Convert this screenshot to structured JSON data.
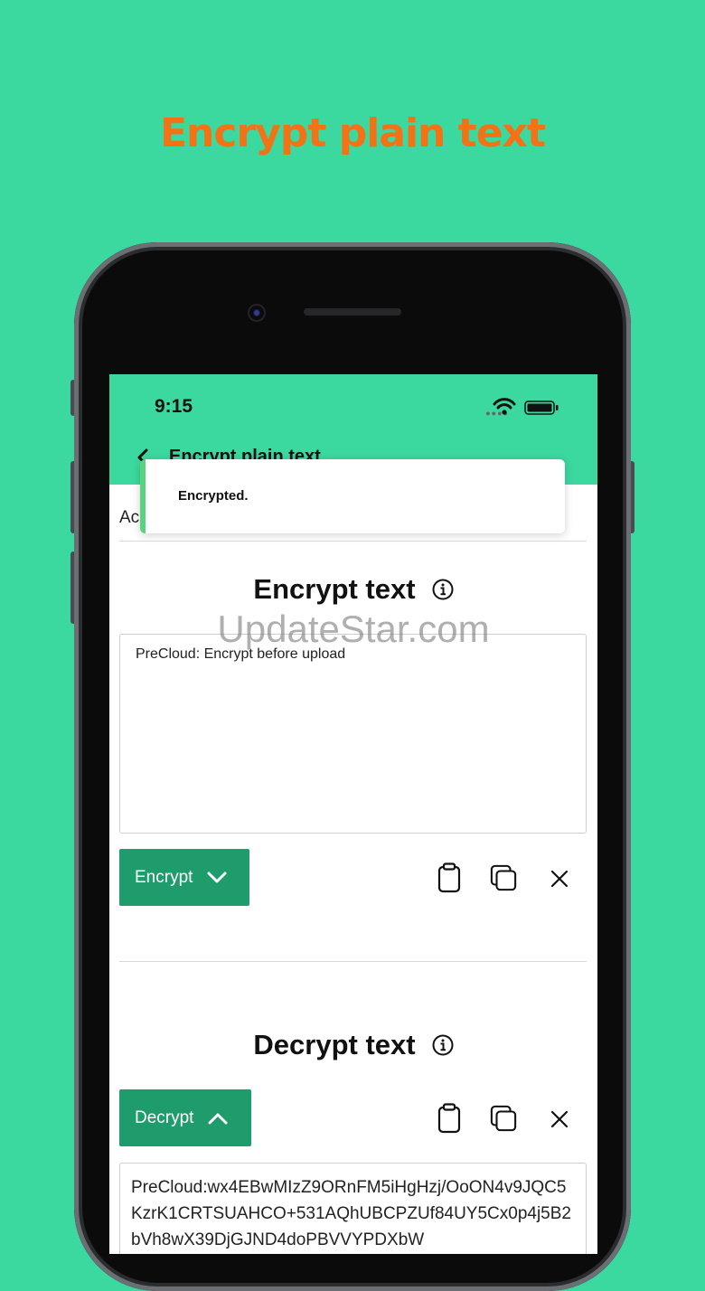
{
  "hero": {
    "title": "Encrypt plain text"
  },
  "status_bar": {
    "time": "9:15"
  },
  "nav": {
    "title": "Encrypt plain text"
  },
  "toast": {
    "message": "Encrypted."
  },
  "peek": {
    "label": "Ac"
  },
  "encrypt_section": {
    "title": "Encrypt text",
    "input_value": "PreCloud: Encrypt before upload",
    "button_label": "Encrypt"
  },
  "decrypt_section": {
    "title": "Decrypt text",
    "button_label": "Decrypt",
    "output_value": "PreCloud:wx4EBwMIzZ9ORnFM5iHgHzj/OoON4v9JQC5KzrK1CRTSUAHCO+531AQhUBCPZUf84UY5Cx0p4j5B2bVh8wX39DjGJND4doPBVVYPDXbW"
  },
  "watermark": "UpdateStar.com",
  "colors": {
    "background": "#3bd89f",
    "hero_title": "#f47216",
    "button": "#1f9c6c",
    "toast_accent": "#5ad37f"
  },
  "icons": [
    "back-chevron-icon",
    "wifi-icon",
    "battery-icon",
    "info-icon",
    "chevron-down-icon",
    "chevron-up-icon",
    "paste-icon",
    "copy-icon",
    "close-icon"
  ]
}
